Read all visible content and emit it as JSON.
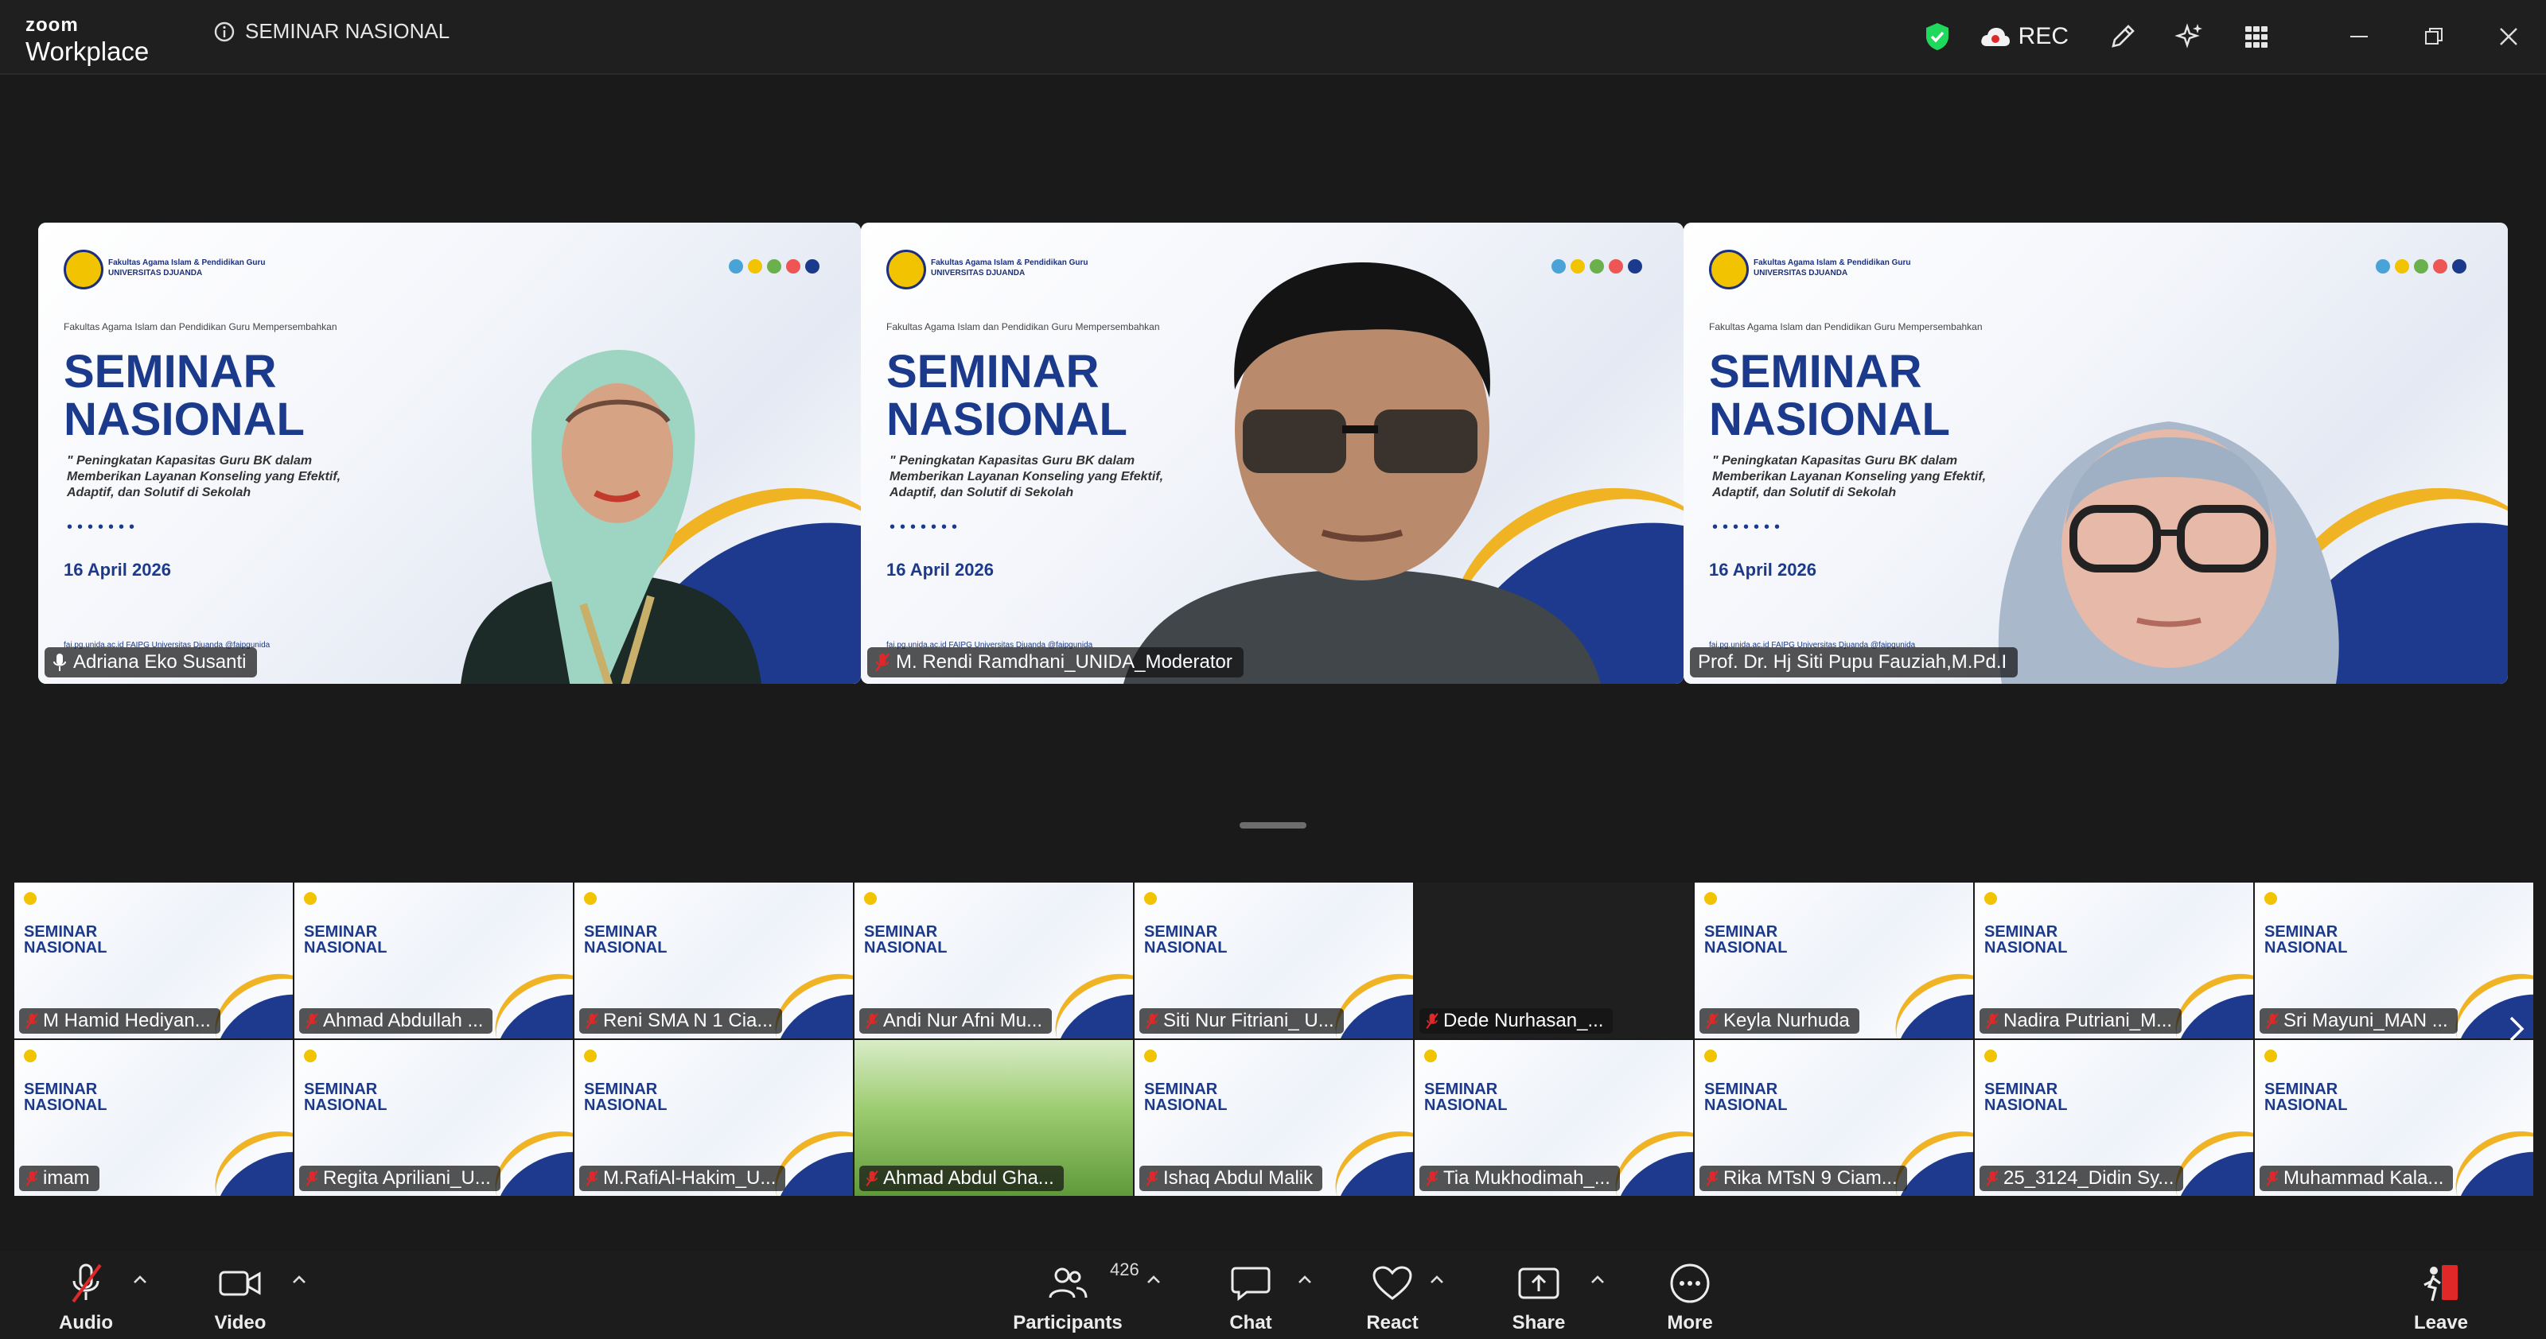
{
  "app": {
    "brand_top": "zoom",
    "brand_bottom": "Workplace",
    "meeting_title": "SEMINAR NASIONAL",
    "rec_label": "REC"
  },
  "colors": {
    "active_speaker": "#1ed95c",
    "muted_mic": "#e02828",
    "shield": "#1ed95c",
    "slide_blue": "#1b3a8c",
    "slide_gold": "#f0b323"
  },
  "slide": {
    "org": "Fakultas Agama Islam & Pendidikan Guru UNIVERSITAS DJUANDA",
    "sub": "Fakultas Agama Islam dan Pendidikan Guru Mempersembahkan",
    "title_line1": "SEMINAR",
    "title_line2": "NASIONAL",
    "topic": "\" Peningkatan Kapasitas Guru BK dalam Memberikan Layanan Konseling yang Efektif, Adaptif, dan Solutif di Sekolah",
    "date": "16 April 2026",
    "footer": "fai.pg.unida.ac.id   FAIPG Universitas Djuanda   @faipgunida"
  },
  "speakers": [
    {
      "name": "Adriana Eko Susanti",
      "active": true,
      "muted": false
    },
    {
      "name": "M. Rendi Ramdhani_UNIDA_Moderator",
      "active": false,
      "muted": true
    },
    {
      "name": "Prof. Dr. Hj Siti Pupu Fauziah,M.Pd.I",
      "active": false,
      "muted": false
    }
  ],
  "gallery_row1": [
    {
      "name": "M Hamid Hediyan...",
      "kind": "slide"
    },
    {
      "name": "Ahmad Abdullah ...",
      "kind": "slide"
    },
    {
      "name": "Reni SMA N 1 Cia...",
      "kind": "slide"
    },
    {
      "name": "Andi Nur Afni Mu...",
      "kind": "slide"
    },
    {
      "name": "Siti Nur Fitriani_ U...",
      "kind": "slide"
    },
    {
      "name": "Dede Nurhasan_...",
      "kind": "dark"
    },
    {
      "name": "Keyla Nurhuda",
      "kind": "slide"
    },
    {
      "name": "Nadira Putriani_M...",
      "kind": "slide"
    },
    {
      "name": "Sri Mayuni_MAN ...",
      "kind": "slide"
    }
  ],
  "gallery_row2": [
    {
      "name": "imam",
      "kind": "slide"
    },
    {
      "name": "Regita Apriliani_U...",
      "kind": "slide"
    },
    {
      "name": "M.RafiAl-Hakim_U...",
      "kind": "slide"
    },
    {
      "name": "Ahmad Abdul Gha...",
      "kind": "grass"
    },
    {
      "name": "Ishaq Abdul Malik",
      "kind": "slide"
    },
    {
      "name": "Tia Mukhodimah_...",
      "kind": "slide"
    },
    {
      "name": "Rika MTsN 9 Ciam...",
      "kind": "slide"
    },
    {
      "name": "25_3124_Didin Sy...",
      "kind": "slide"
    },
    {
      "name": "Muhammad Kala...",
      "kind": "slide"
    }
  ],
  "toolbar": {
    "audio": "Audio",
    "video": "Video",
    "participants": "Participants",
    "participants_count": "426",
    "chat": "Chat",
    "react": "React",
    "share": "Share",
    "more": "More",
    "leave": "Leave"
  }
}
